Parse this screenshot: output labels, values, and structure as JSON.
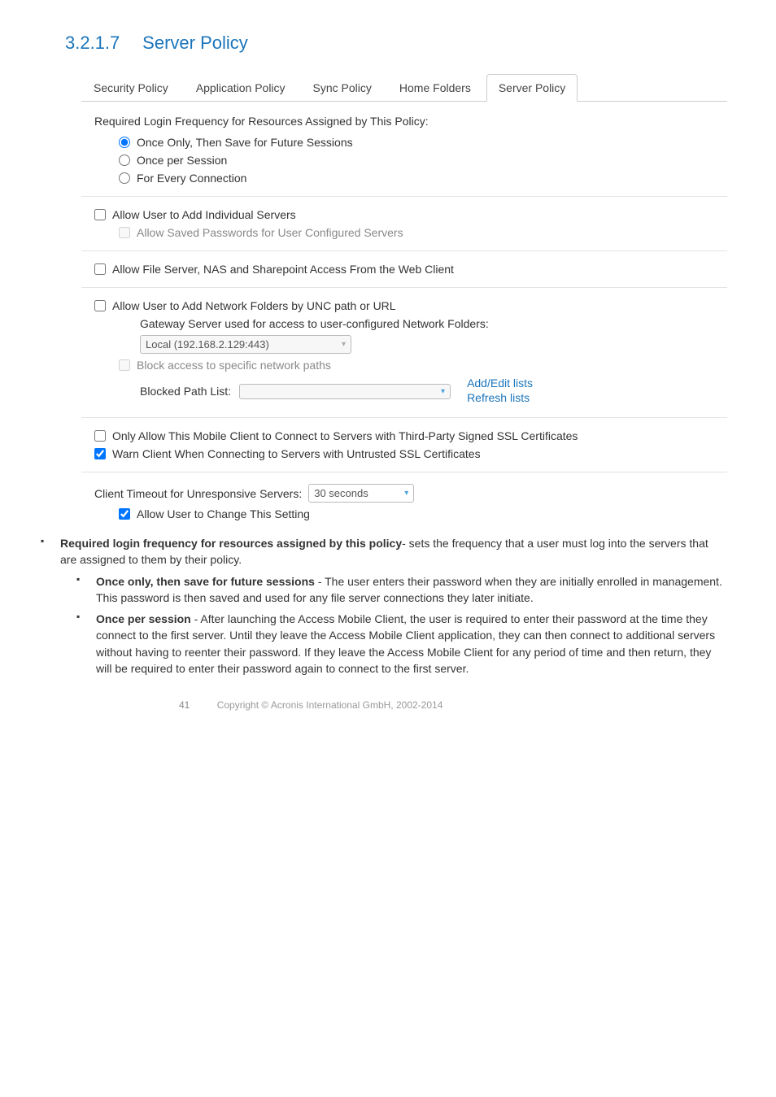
{
  "heading": {
    "number": "3.2.1.7",
    "title": "Server Policy"
  },
  "tabs": {
    "security": "Security Policy",
    "application": "Application Policy",
    "sync": "Sync Policy",
    "home": "Home Folders",
    "server": "Server Policy"
  },
  "required_login_label": "Required Login Frequency for Resources Assigned by This Policy:",
  "radios": {
    "once_only": "Once Only, Then Save for Future Sessions",
    "once_per_session": "Once per Session",
    "for_every": "For Every Connection"
  },
  "individual": {
    "allow_add": "Allow User to Add Individual Servers",
    "allow_saved": "Allow Saved Passwords for User Configured Servers"
  },
  "file_server_nas": "Allow File Server, NAS and Sharepoint Access From the Web Client",
  "network": {
    "allow_unc": "Allow User to Add Network Folders by UNC path or URL",
    "gateway_label": "Gateway Server used for access to user-configured Network Folders:",
    "gateway_value": "Local (192.168.2.129:443)",
    "block_access": "Block access to specific network paths",
    "blocked_list_label": "Blocked Path List:",
    "add_edit": "Add/Edit lists",
    "refresh": "Refresh lists"
  },
  "ssl": {
    "only_allow": "Only Allow This Mobile Client to Connect to Servers with Third-Party Signed SSL Certificates",
    "warn": "Warn Client When Connecting to Servers with Untrusted SSL Certificates"
  },
  "timeout": {
    "label": "Client Timeout for Unresponsive Servers:",
    "value": "30 seconds",
    "allow_change": "Allow User to Change This Setting"
  },
  "desc": {
    "req_bold": "Required login frequency for resources assigned by this policy",
    "req_rest": "- sets the frequency that a user must log into the servers that are assigned to them by their policy.",
    "once_bold": "Once only, then save for future sessions",
    "once_rest": " - The user enters their password when they are initially enrolled in management. This password is then saved and used for any file server connections they later initiate.",
    "sess_bold": "Once per session",
    "sess_rest": " - After launching the Access Mobile Client, the user is required to enter their password at the time they connect to the first server. Until they leave the Access Mobile Client application, they can then connect to additional servers without having to reenter their password. If they leave the Access Mobile Client for any period of time and then return, they will be required to enter their password again to connect to the first server."
  },
  "footer": {
    "page": "41",
    "copyright": "Copyright © Acronis International GmbH, 2002-2014"
  }
}
